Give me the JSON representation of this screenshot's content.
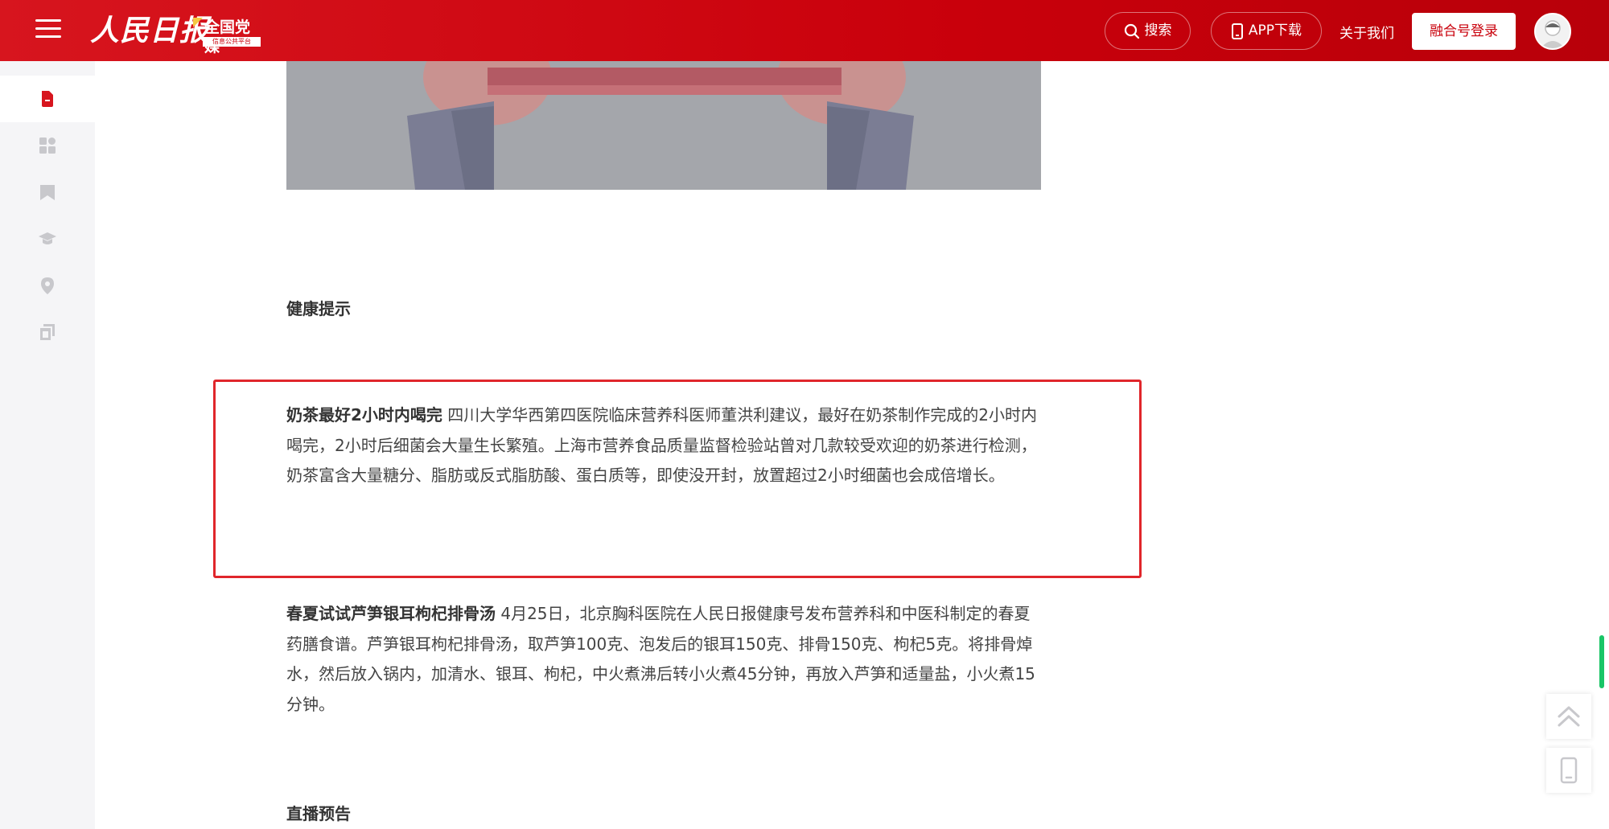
{
  "header": {
    "logo_text": "人民日报",
    "badge_text": "全国党媒",
    "badge_sub": "信息公共平台",
    "search_label": "搜索",
    "app_label": "APP下载",
    "about_label": "关于我们",
    "login_label": "融合号登录"
  },
  "sidebar": {
    "items": [
      {
        "name": "article",
        "active": true
      },
      {
        "name": "grid"
      },
      {
        "name": "bookmark"
      },
      {
        "name": "education"
      },
      {
        "name": "location"
      },
      {
        "name": "copy"
      }
    ]
  },
  "article": {
    "section1_title": "健康提示",
    "para1_lead": "奶茶最好2小时内喝完",
    "para1_body": " 四川大学华西第四医院临床营养科医师董洪利建议，最好在奶茶制作完成的2小时内喝完，2小时后细菌会大量生长繁殖。上海市营养食品质量监督检验站曾对几款较受欢迎的奶茶进行检测，奶茶富含大量糖分、脂肪或反式脂肪酸、蛋白质等，即使没开封，放置超过2小时细菌也会成倍增长。",
    "para2_lead": "春夏试试芦笋银耳枸杞排骨汤",
    "para2_body": " 4月25日，北京胸科医院在人民日报健康号发布营养科和中医科制定的春夏药膳食谱。芦笋银耳枸杞排骨汤，取芦笋100克、泡发后的银耳150克、排骨150克、枸杞5克。将排骨焯水，然后放入锅内，加清水、银耳、枸杞，中火煮沸后转小火煮45分钟，再放入芦笋和适量盐，小火煮15分钟。",
    "section2_title": "直播预告"
  },
  "colors": {
    "brand_red": "#c9000b",
    "highlight_border": "#e0262b",
    "scroll_indicator": "#19c566"
  }
}
